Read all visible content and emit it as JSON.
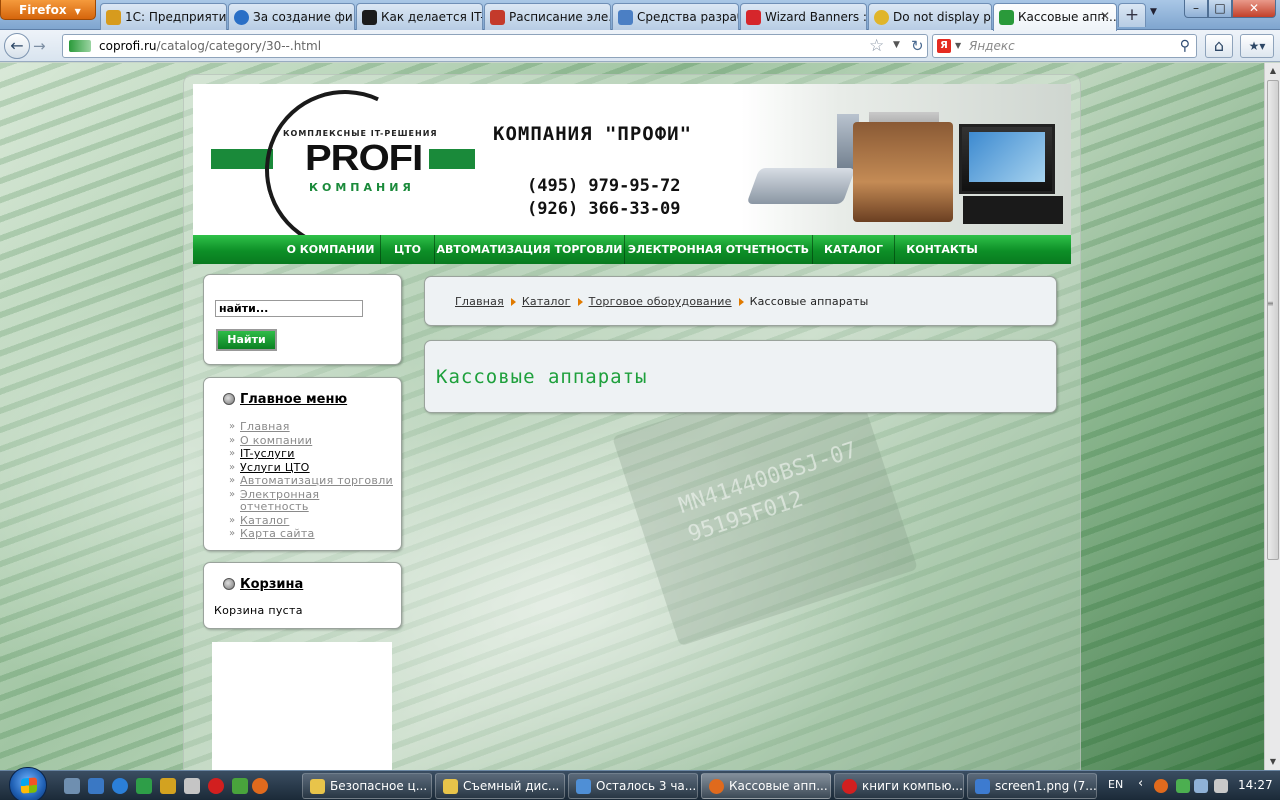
{
  "browser": {
    "app_button": "Firefox",
    "tabs": [
      {
        "label": "1С: Предприяти...",
        "color": "#d79b1d"
      },
      {
        "label": "За создание фи...",
        "color": "#2a6fc6"
      },
      {
        "label": "Как делается IT-...",
        "color": "#1b1b1b"
      },
      {
        "label": "Расписание эле...",
        "color": "#c43a2b"
      },
      {
        "label": "Средства разраб...",
        "color": "#4b7fc4"
      },
      {
        "label": "Wizard Banners ::...",
        "color": "#d6262b"
      },
      {
        "label": "Do not display pr...",
        "color": "#e0b52a"
      },
      {
        "label": "Кассовые апп...",
        "color": "#2a9a3a"
      }
    ],
    "url_domain": "coprofi.ru",
    "url_path": "/catalog/category/30--.html",
    "search_placeholder": "Яндекс",
    "search_engine_glyph": "Я"
  },
  "header": {
    "logo_tagline": "КОМПЛЕКСНЫЕ IT-РЕШЕНИЯ",
    "logo_main": "PROFI",
    "logo_sub": "КОМПАНИЯ",
    "company": "КОМПАНИЯ \"ПРОФИ\"",
    "phone1": "(495) 979-95-72",
    "phone2": "(926) 366-33-09"
  },
  "topmenu": {
    "items": [
      "О КОМПАНИИ",
      "ЦТО",
      "АВТОМАТИЗАЦИЯ ТОРГОВЛИ",
      "ЭЛЕКТРОННАЯ ОТЧЕТНОСТЬ",
      "КАТАЛОГ",
      "КОНТАКТЫ"
    ]
  },
  "search": {
    "value": "найти...",
    "button": "Найти"
  },
  "mainmenu": {
    "title": "Главное меню",
    "items": [
      "Главная",
      "О компании",
      "IT-услуги",
      "Услуги ЦТО",
      "Автоматизация торговли",
      "Электронная",
      "отчетность",
      "Каталог",
      "Карта сайта"
    ]
  },
  "cart": {
    "title": "Корзина",
    "empty": "Корзина пуста"
  },
  "breadcrumb": {
    "items": [
      "Главная",
      "Каталог",
      "Торговое оборудование"
    ],
    "current": "Кассовые аппараты"
  },
  "page": {
    "title": "Кассовые аппараты"
  },
  "background_chip": {
    "line1": "MN414400BSJ-07",
    "line2": "95195F012"
  },
  "taskbar": {
    "tasks": [
      {
        "label": "Безопасное ц...",
        "color": "#e8c44a"
      },
      {
        "label": "Съемный дис...",
        "color": "#e8c44a"
      },
      {
        "label": "Осталось 3 ча...",
        "color": "#4f8fd6"
      },
      {
        "label": "Кассовые апп...",
        "color": "#e06a1d"
      },
      {
        "label": "книги компью...",
        "color": "#d21f1f"
      },
      {
        "label": "screen1.png (7...",
        "color": "#3d7bd0"
      }
    ],
    "lang": "EN",
    "time": "14:27"
  }
}
